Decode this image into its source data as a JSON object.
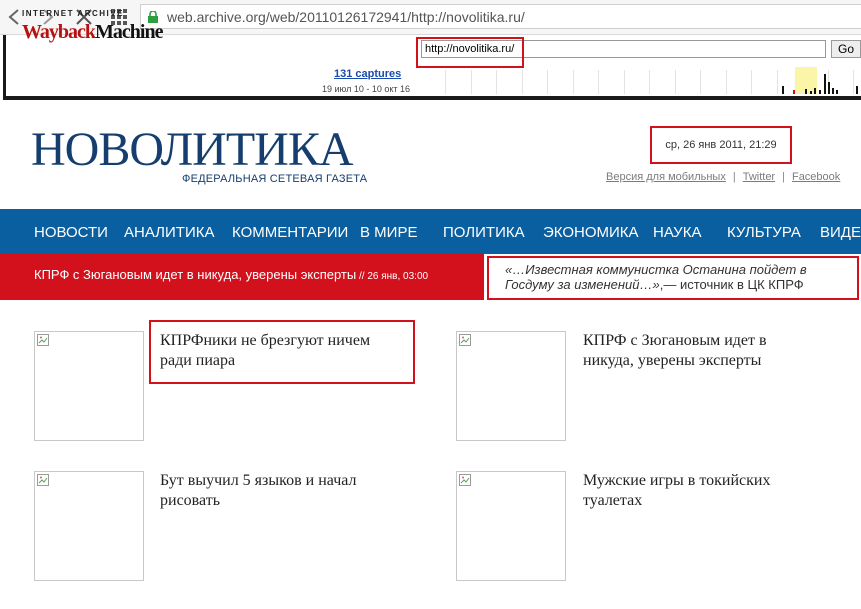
{
  "browser": {
    "url": "web.archive.org/web/20110126172941/http://novolitika.ru/"
  },
  "wayback": {
    "ia_label": "INTERNET ARCHIVE",
    "logo_part1": "Wayback",
    "logo_part2": "Machine",
    "url_value": "http://novolitika.ru/",
    "go_label": "Go",
    "captures": "131 captures",
    "range": "19 июл 10 - 10 окт 16"
  },
  "site": {
    "logo": "НОВОЛИТИКА",
    "tagline": "ФЕДЕРАЛЬНАЯ СЕТЕВАЯ ГАЗЕТА",
    "date": "ср, 26 янв 2011, 21:29",
    "links": [
      "Версия для мобильных",
      "Twitter",
      "Facebook"
    ],
    "separator": "|"
  },
  "nav": {
    "items": [
      "НОВОСТИ",
      "АНАЛИТИКА",
      "КОММЕНТАРИИ",
      "В МИРЕ",
      "ПОЛИТИКА",
      "ЭКОНОМИКА",
      "НАУКА",
      "КУЛЬТУРА",
      "ВИДЕО"
    ]
  },
  "ticker": {
    "headline": "КПРФ с Зюгановым идет в никуда, уверены эксперты",
    "time": " // 26 янв, 03:00"
  },
  "quote": {
    "text": "«…Известная коммунистка Останина пойдет в Госдуму за изменений…»",
    "source": ",— источник в ЦК КПРФ"
  },
  "articles": [
    {
      "title": "КПРФники не брезгуют ничем ради пиара"
    },
    {
      "title": "КПРФ с Зюгановым идет в никуда, уверены эксперты"
    },
    {
      "title": "Бут выучил 5 языков и начал рисовать"
    },
    {
      "title": "Мужские игры в токийских туалетах"
    }
  ],
  "colors": {
    "nav_bg": "#0a5fa0",
    "ticker_bg": "#d3111c",
    "logo": "#153e6e",
    "highlight_box": "#d3111c"
  }
}
